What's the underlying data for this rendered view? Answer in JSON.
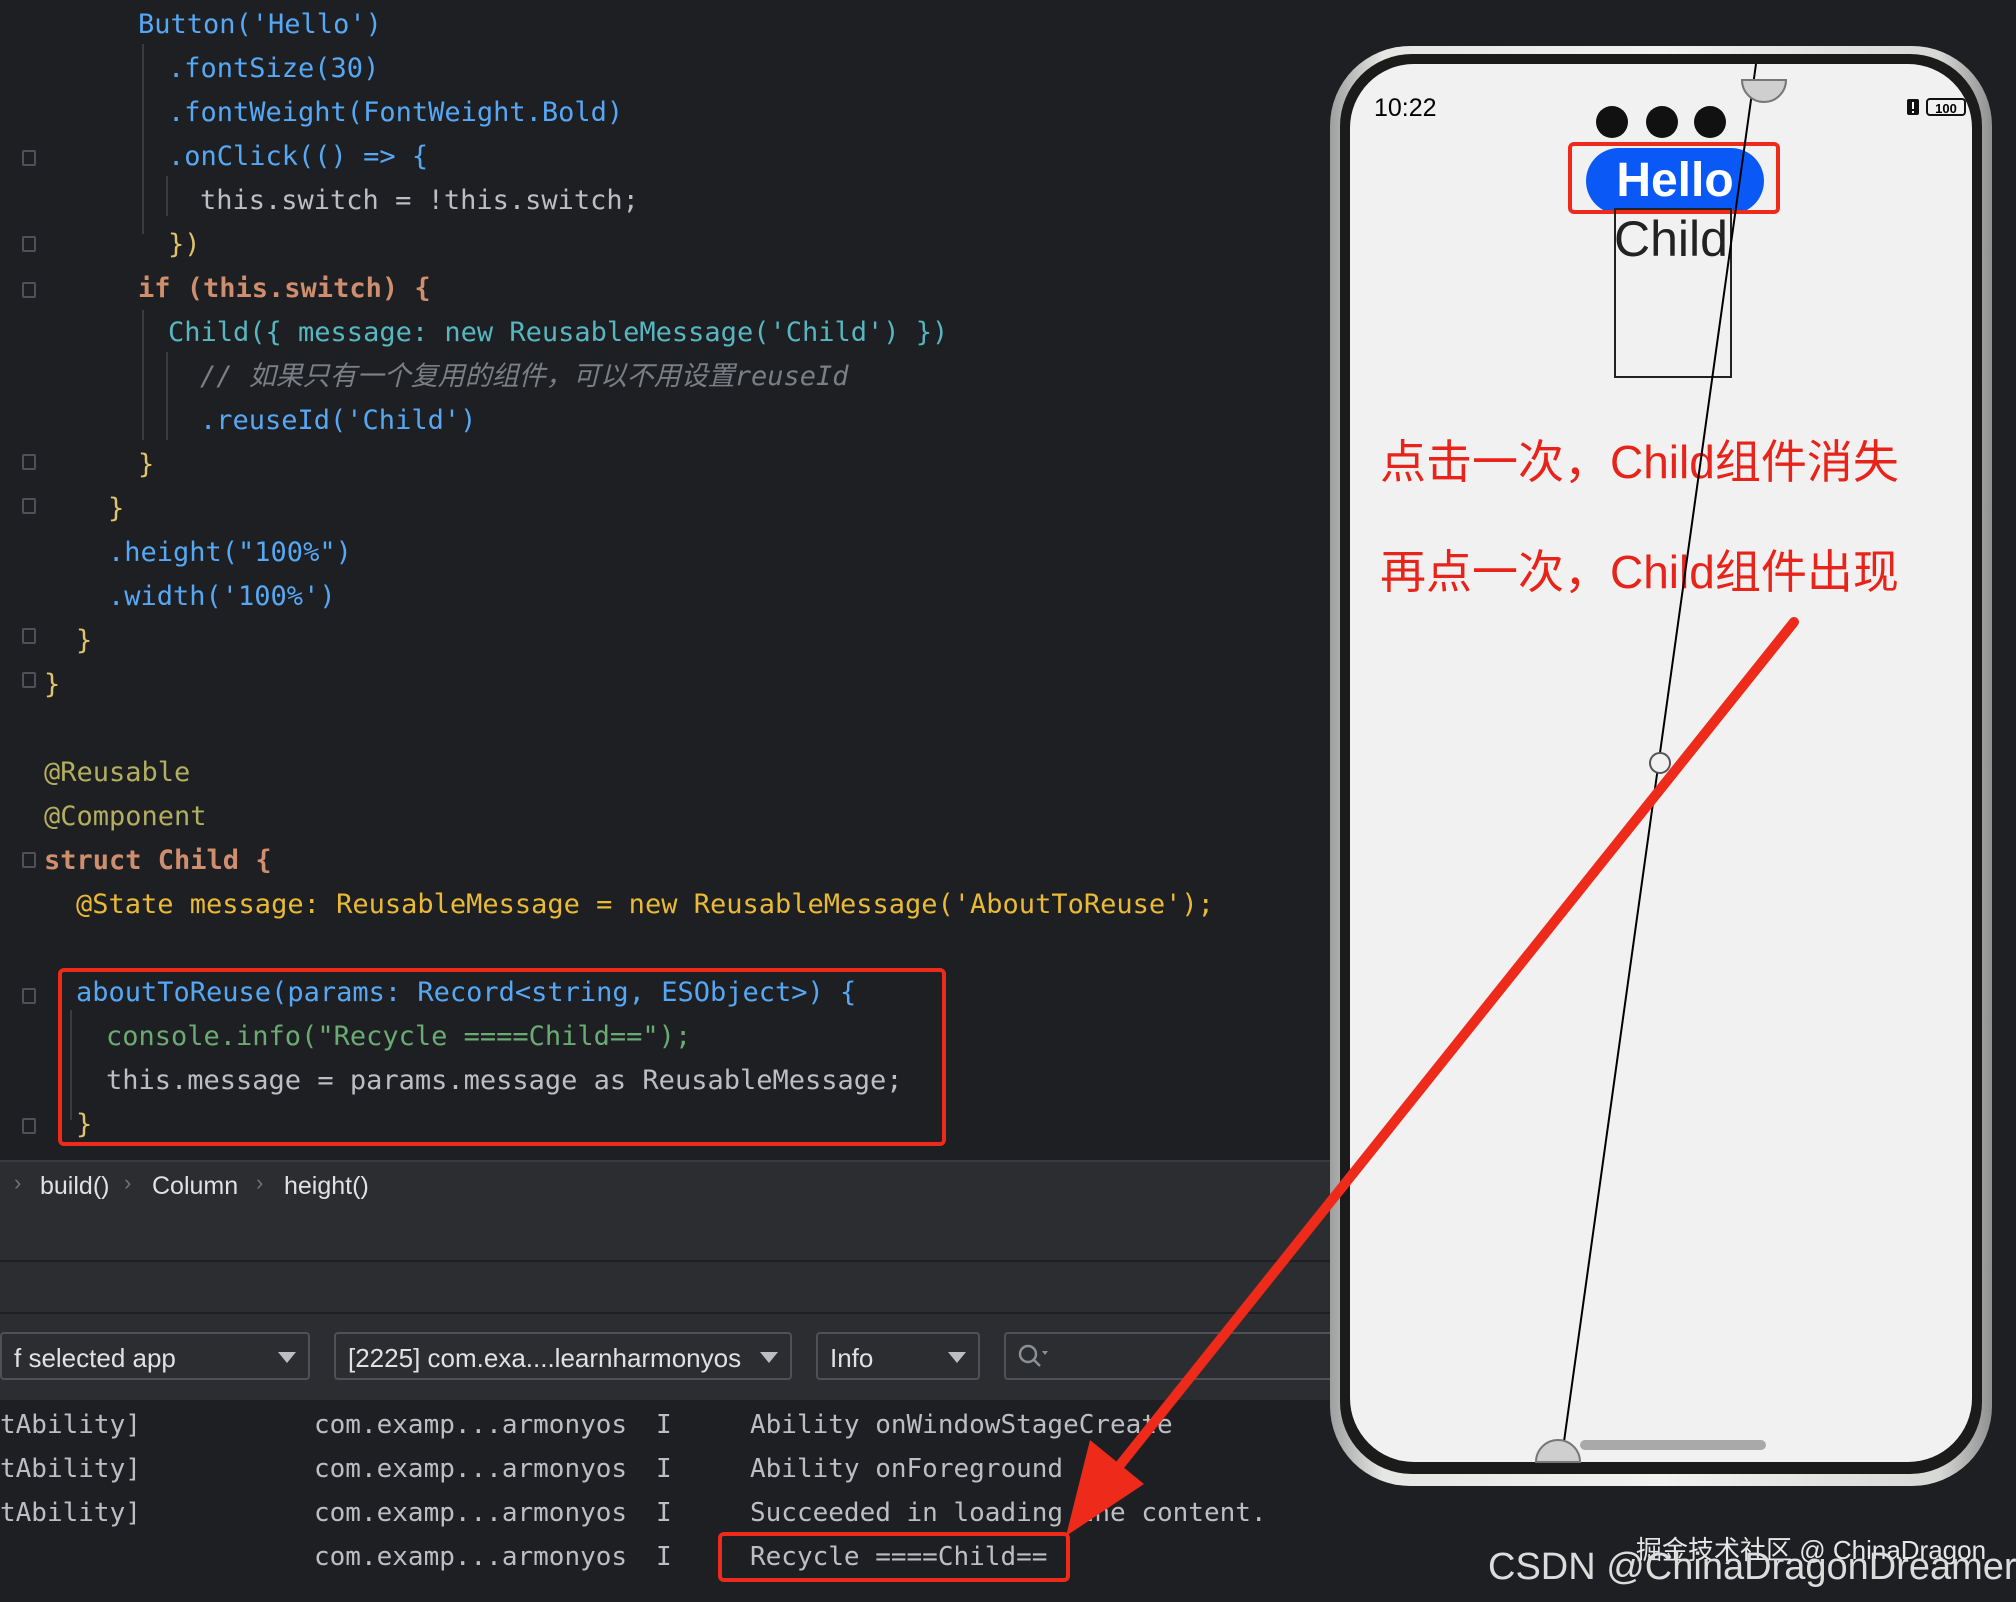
{
  "code": {
    "line_hello_button": "Button('Hello')",
    "line_fontsize": ".fontSize(30)",
    "line_fontweight": ".fontWeight(FontWeight.Bold)",
    "line_onclick": ".onClick(() => {",
    "line_switch": "this.switch = !this.switch;",
    "line_close_onclick": "})",
    "line_if": "if (this.switch) {",
    "line_child_call": "Child({ message: new ReusableMessage('Child') })",
    "line_comment": "// 如果只有一个复用的组件，可以不用设置reuseId",
    "line_reuseid": ".reuseId('Child')",
    "line_close_if": "}",
    "line_close_column": "}",
    "line_height": ".height(\"100%\")",
    "line_width": ".width('100%')",
    "line_close_build": "}",
    "line_close_struct": "}",
    "line_reusable": "@Reusable",
    "line_component": "@Component",
    "line_struct": "struct Child {",
    "line_state": "@State message: ReusableMessage = new ReusableMessage('AboutToReuse');",
    "line_about_to_reuse": "aboutToReuse(params: Record<string, ESObject>) {",
    "line_console": "console.info(\"Recycle ====Child==\");",
    "line_assign": "this.message = params.message as ReusableMessage;",
    "line_close_fn": "}"
  },
  "breadcrumb": {
    "items": [
      "build()",
      "Column",
      "height()"
    ]
  },
  "filters": {
    "app_filter": "f selected app",
    "process_filter": "[2225] com.exa....learnharmonyos",
    "level_filter": "Info",
    "search_placeholder": ""
  },
  "log_rows": [
    {
      "tag": "tAbility]",
      "pkg": "com.examp...armonyos",
      "level": "I",
      "msg": "Ability onWindowStageCreate"
    },
    {
      "tag": "tAbility]",
      "pkg": "com.examp...armonyos",
      "level": "I",
      "msg": "Ability onForeground"
    },
    {
      "tag": "tAbility]",
      "pkg": "com.examp...armonyos",
      "level": "I",
      "msg": "Succeeded in loading the content."
    },
    {
      "tag": "",
      "pkg": "com.examp...armonyos",
      "level": "I",
      "msg": "Recycle ====Child=="
    }
  ],
  "phone": {
    "time": "10:22",
    "battery": "100",
    "hello_label": "Hello",
    "child_label": "Child",
    "note_1": "点击一次，Child组件消失",
    "note_2": "再点一次，Child组件出现"
  },
  "watermark": {
    "juejin": "掘金技术社区 @ ChinaDragon",
    "csdn": "CSDN @ChinaDragonDreamer"
  },
  "colors": {
    "annotation_red": "#ee2a1b",
    "button_blue": "#0a59f7"
  }
}
